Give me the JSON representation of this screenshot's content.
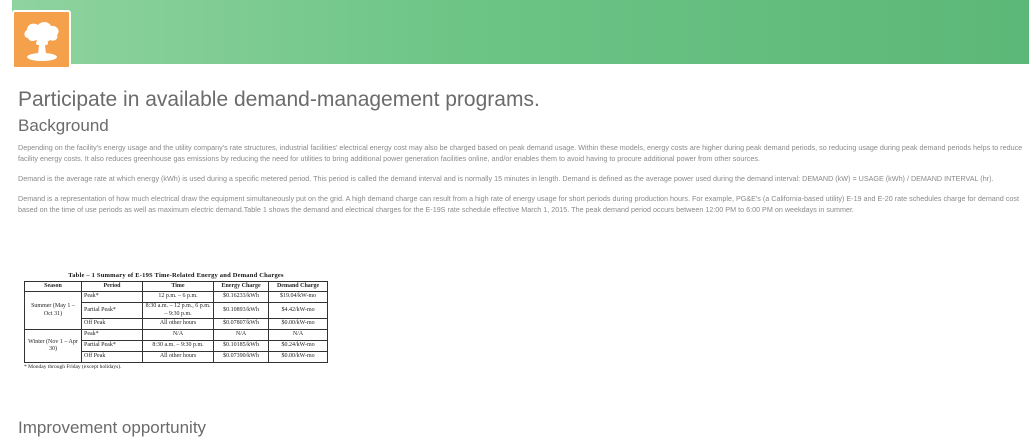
{
  "colors": {
    "header_green": "#6cc485",
    "logo_orange": "#f5a04a"
  },
  "logo": {
    "icon": "mushroom-cloud-icon"
  },
  "page_title": "Participate in available demand-management programs.",
  "background": {
    "title": "Background",
    "paragraphs": [
      "Depending on the facility's energy usage and the utility company's rate structures, industrial facilities' electrical energy cost may also be charged based on peak demand usage. Within these models, energy costs are higher during peak demand periods, so reducing usage during peak demand periods helps to reduce facility energy costs. It also reduces greenhouse gas emissions by reducing the need for utilities to bring additional power generation facilities online, and/or enables them to avoid having to procure additional power from other sources.",
      "Demand is the average rate at which energy (kWh) is used during a specific metered period. This period is called the demand interval and is normally 15 minutes in length. Demand is defined as the average power used during the demand interval:  DEMAND (kW) = USAGE (kWh) / DEMAND INTERVAL (hr).",
      "Demand is a representation of how much electrical draw the equipment simultaneously put on the grid. A high demand charge can result from a high rate of energy usage for short periods during production hours. For example, PG&E's (a California-based utility) E-19 and E-20 rate schedules charge for demand cost based on the time of use periods as well as maximum electric demand.Table 1 shows the demand and electrical charges for the E-19S rate schedule effective March 1, 2015. The peak demand period occurs between 12:00 PM to 6:00 PM on weekdays in summer."
    ]
  },
  "table": {
    "caption": "Table – 1 Summary of E-19S Time-Related Energy and Demand Charges",
    "headers": [
      "Season",
      "Period",
      "Time",
      "Energy Charge",
      "Demand Charge"
    ],
    "seasons": {
      "summer": "Summer (May 1 – Oct 31)",
      "winter": "Winter (Nov 1 – Apr 30)"
    },
    "rows": [
      {
        "period": "Peak*",
        "time": "12 p.m. – 6 p.m.",
        "energy": "$0.16233/kWh",
        "demand": "$19.04/kW-mo"
      },
      {
        "period": "Partial Peak*",
        "time": "8:30 a.m. – 12 p.m., 6 p.m. – 9:30 p.m.",
        "energy": "$0.10893/kWh",
        "demand": "$4.42/kW-mo"
      },
      {
        "period": "Off Peak",
        "time": "All other hours",
        "energy": "$0.07807/kWh",
        "demand": "$0.00/kW-mo"
      },
      {
        "period": "Peak*",
        "time": "N/A",
        "energy": "N/A",
        "demand": "N/A"
      },
      {
        "period": "Partial Peak*",
        "time": "8:30 a.m. – 9:30 p.m.",
        "energy": "$0.10185/kWh",
        "demand": "$0.24/kW-mo"
      },
      {
        "period": "Off Peak",
        "time": "All other hours",
        "energy": "$0.07390/kWh",
        "demand": "$0.00/kW-mo"
      }
    ],
    "footnote": "* Monday through Friday (except holidays)."
  },
  "improvement": {
    "title": "Improvement opportunity"
  }
}
